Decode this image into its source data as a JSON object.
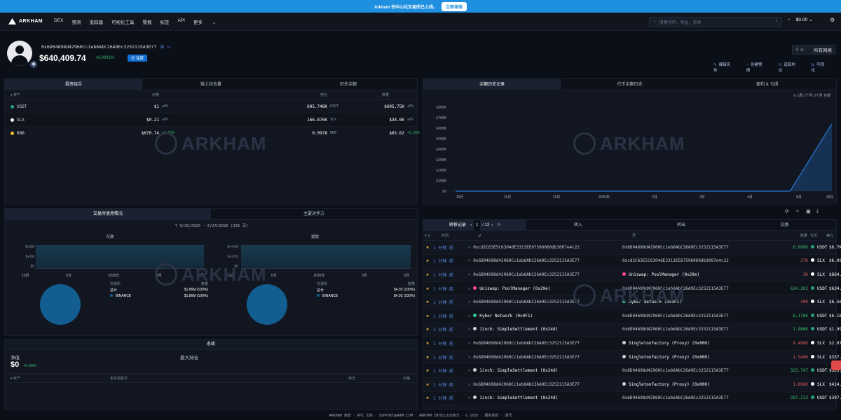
{
  "banner": {
    "text": "Arkham 去中心化交易所已上线。",
    "button": "立即体验"
  },
  "nav": {
    "logo": "ARKHAM",
    "items": [
      "DEX",
      "预测",
      "追踪器",
      "可视化工具",
      "警报",
      "标签",
      "API",
      "更多"
    ],
    "search_placeholder": "搜索代币、地址、实体",
    "search_key": "/",
    "plus": "+",
    "balance": "$0.00"
  },
  "profile": {
    "address": "0x6D04698d42960Cc1eb6AbC26A9Ec3252115A3E77",
    "copy_icon": "⧉ ⤳",
    "balance": "$640,409.74",
    "change": "+0.0001%",
    "tag": "⊕ 深度",
    "chain_selector": "所有网络",
    "actions": [
      "编辑实体",
      "创建警报",
      "追踪地址",
      "可视化"
    ]
  },
  "holdings": {
    "tabs": [
      "投资组合",
      "链上持仓量",
      "历史余额"
    ],
    "headers": {
      "asset": "资产",
      "price": "价格",
      "holding": "持仓",
      "value": "数量"
    },
    "rows": [
      {
        "symbol": "USDT",
        "color": "#26a17b",
        "price": "$1",
        "price_chg": "±0%",
        "qty": "605.746K",
        "qsym": "USDT",
        "value": "$605.75K",
        "vchg": "±0%"
      },
      {
        "symbol": "SLX",
        "color": "#ffffff",
        "price": "$0.21",
        "price_chg": "±0%",
        "qty": "166.876K",
        "qsym": "SLX",
        "value": "$34.6K",
        "vchg": "±0%"
      },
      {
        "symbol": "BNB",
        "color": "#f3ba2f",
        "price": "$670.74",
        "price_chg": "+1.83%",
        "qty": "0.0978",
        "qsym": "BNB",
        "value": "$65.62",
        "vchg": "+1.83%"
      }
    ]
  },
  "balance_chart": {
    "tabs": [
      "余额历史记录",
      "代币余额历史",
      "盈利 & 亏损"
    ],
    "range_label": "◷ 1周 1个月 3个月 全部",
    "watermark": "ARKHAM"
  },
  "chart_data": {
    "type": "area",
    "title": "",
    "x": [
      "10月",
      "11月",
      "12月",
      "2026年",
      "2月",
      "3月",
      "4月",
      "5月",
      "10月"
    ],
    "y_ticks": [
      "$0",
      "$100K",
      "$200K",
      "$300K",
      "$400K",
      "$500K",
      "$600K",
      "$700K",
      "$800K"
    ],
    "ylim": [
      0,
      800000
    ],
    "series": [
      {
        "values": [
          0,
          0,
          0,
          0,
          0,
          0,
          0,
          0,
          0,
          640409.74
        ]
      }
    ],
    "color": "#2a7ad6"
  },
  "exchange": {
    "tabs": [
      "交易所使用情况",
      "主要对手方"
    ],
    "date_range": "9/30/2025 - 6/24/2026  (336 天)",
    "deposit": {
      "title": "存款",
      "y_ticks": [
        "$0",
        "$+1M",
        "$+2M"
      ],
      "x": [
        "10月",
        "6日",
        "2026年",
        "3月",
        "6月"
      ],
      "col1": "交易所",
      "col2": "数量",
      "total_label": "总计",
      "total": "$1.86M (100%)",
      "name": "BINANCE",
      "name_val": "$1.86M (100%)"
    },
    "withdraw": {
      "title": "提款",
      "y_ticks": [
        "$0",
        "$+2.00",
        "$+4.00"
      ],
      "x": [
        "10月",
        "6日",
        "2026年",
        "3月",
        "6月"
      ],
      "col1": "交易所",
      "col2": "数量",
      "total_label": "总计",
      "total": "$4.02 (100%)",
      "name": "BINANCE",
      "name_val": "$4.02 (100%)"
    }
  },
  "perps": {
    "title": "永续",
    "net_label": "净值",
    "net_value": "$0",
    "net_change": "+0.00%",
    "max_label": "最大持仓",
    "headers": [
      "资产",
      "未实现盈亏",
      "持仓",
      "价格"
    ]
  },
  "transfers": {
    "tabs": [
      "转移记录",
      "转入",
      "转出",
      "交换"
    ],
    "page": "1",
    "pages": "/ 12",
    "headers": [
      "时间",
      "从",
      "至",
      "数量",
      "代币",
      "美元"
    ],
    "rows": [
      {
        "time": "1 分钟 前",
        "from": "0xcd2C63E5C6304dE3313EE67596060db3007e4c22",
        "to": "0x6D04698d42960Cc1eb6AbC26A9Ec3252115A3E77",
        "amount": "6.699K",
        "amt_color": "green",
        "token": "USDT",
        "usd": "$6.7K"
      },
      {
        "time": "1 分钟 前",
        "from": "0x6D04698d42960Cc1eb6AbC26A9Ec3252115A3E77",
        "to": "0xcd2C63E5C6304dE3313EE67596060db3007e4c22",
        "amount": "27K",
        "amt_color": "red",
        "token": "SLX",
        "usd": "$6.09K"
      },
      {
        "time": "1 分钟 前",
        "from": "0x6D04698d42960Cc1eb6AbC26A9Ec3252115A3E77",
        "to": "Uniswap: PoolManager (0x29e)",
        "amount": "3K",
        "amt_color": "red",
        "token": "SLX",
        "usd": "$664.74"
      },
      {
        "time": "1 分钟 前",
        "from": "Uniswap: PoolManager (0x29e)",
        "to": "0x6D04698d42960Cc1eb6AbC26A9Ec3252115A3E77",
        "amount": "634.203",
        "amt_color": "green",
        "token": "USDT",
        "usd": "$634.20"
      },
      {
        "time": "1 分钟 前",
        "from": "0x6D04698d42960Cc1eb6AbC26A9Ec3252115A3E77",
        "to": "Kyber Network (0x0F1)",
        "amount": "30K",
        "amt_color": "red",
        "token": "SLX",
        "usd": "$6.56K"
      },
      {
        "time": "1 分钟 前",
        "from": "Kyber Network (0x0F1)",
        "to": "0x6D04698d42960Cc1eb6AbC26A9Ec3252115A3E77",
        "amount": "6.176K",
        "amt_color": "green",
        "token": "USDT",
        "usd": "$6.18K"
      },
      {
        "time": "1 分钟 前",
        "from": "1inch: SimpleSettlement (0x24d)",
        "to": "0x6D04698d42960Cc1eb6AbC26A9Ec3252115A3E77",
        "amount": "1.986K",
        "amt_color": "green",
        "token": "USDT",
        "usd": "$1.99K"
      },
      {
        "time": "1 分钟 前",
        "from": "0x6D04698d42960Cc1eb6AbC26A9Ec3252115A3E77",
        "to": "SingletonFactory (Proxy) (0x000)",
        "amount": "9.496K",
        "amt_color": "red",
        "token": "SLX",
        "usd": "$2.07K"
      },
      {
        "time": "1 分钟 前",
        "from": "0x6D04698d42960Cc1eb6AbC26A9Ec3252115A3E77",
        "to": "SingletonFactory (Proxy) (0x000)",
        "amount": "1.544K",
        "amt_color": "red",
        "token": "SLX",
        "usd": "$337.92"
      },
      {
        "time": "1 分钟 前",
        "from": "1inch: SimpleSettlement (0x24d)",
        "to": "0x6D04698d42960Cc1eb6AbC26A9Ec3252115A3E77",
        "amount": "323.747",
        "amt_color": "green",
        "token": "USDT",
        "usd": "$323.75"
      },
      {
        "time": "1 分钟 前",
        "from": "0x6D04698d42960Cc1eb6AbC26A9Ec3252115A3E77",
        "to": "SingletonFactory (Proxy) (0x000)",
        "amount": "1.896K",
        "amt_color": "red",
        "token": "SLX",
        "usd": "$414.61"
      },
      {
        "time": "1 分钟 前",
        "from": "1inch: SimpleSettlement (0x24d)",
        "to": "0x6D04698d42960Cc1eb6AbC26A9Ec3252115A3E77",
        "amount": "397.213",
        "amt_color": "green",
        "token": "USDT",
        "usd": "$397.21"
      }
    ]
  },
  "footer": "ARKHAM 条款 · API 文档 · SUPPORT@ARKM.COM · ARKHAM INTELLIGENCE · © 2026 · 服务条款 · 通讯"
}
